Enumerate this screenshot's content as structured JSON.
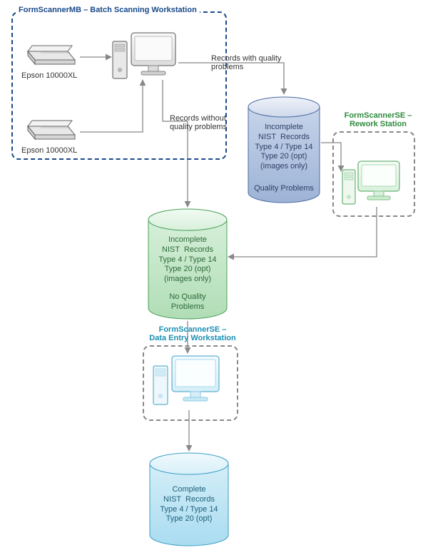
{
  "boxes": {
    "batch": {
      "title": "FormScannerMB – Batch Scanning Workstation",
      "color": "#1a4a8a"
    },
    "rework": {
      "title": "FormScannerSE –\nRework Station",
      "color": "#2e8b3d"
    },
    "dataentry": {
      "title": "FormScannerSE –\nData Entry Workstation",
      "color": "#1a8fb3"
    }
  },
  "scanners": {
    "top": "Epson 10000XL",
    "bottom": "Epson 10000XL"
  },
  "arrows": {
    "with_problems": "Records with quality\nproblems",
    "without_problems": "Records without\nquality problems"
  },
  "cylinders": {
    "quality": {
      "lines": "Incomplete\nNIST  Records\nType 4 / Type 14\nType 20 (opt)\n(images only)",
      "footer": "Quality Problems",
      "stroke": "#4a6aa0",
      "fillTop": "#dfe6f2",
      "fillBody": "#b7c7e2"
    },
    "noquality": {
      "lines": "Incomplete\nNIST  Records\nType 4 / Type 14\nType 20 (opt)\n(images only)",
      "footer": "No Quality\nProblems",
      "stroke": "#4aa05a",
      "fillTop": "#e7f5e9",
      "fillBody": "#cdeccf"
    },
    "complete": {
      "lines": "Complete\nNIST  Records\nType 4 / Type 14\nType 20 (opt)",
      "footer": "",
      "stroke": "#3b9fc6",
      "fillTop": "#e4f4fb",
      "fillBody": "#c7e9f6"
    }
  }
}
